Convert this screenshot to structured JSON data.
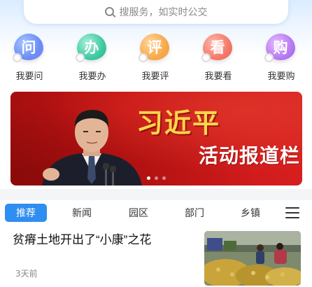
{
  "search": {
    "placeholder": "搜服务，如实时公交"
  },
  "actions": [
    {
      "glyph": "问",
      "label": "我要问",
      "icon": "ask-icon"
    },
    {
      "glyph": "办",
      "label": "我要办",
      "icon": "handle-icon"
    },
    {
      "glyph": "评",
      "label": "我要评",
      "icon": "review-icon"
    },
    {
      "glyph": "看",
      "label": "我要看",
      "icon": "watch-icon"
    },
    {
      "glyph": "购",
      "label": "我要购",
      "icon": "shop-icon"
    }
  ],
  "banner": {
    "title": "习近平",
    "subtitle": "活动报道栏",
    "pages": 3,
    "active_page": 1
  },
  "tabs": [
    {
      "label": "推荐",
      "active": true
    },
    {
      "label": "新闻",
      "active": false
    },
    {
      "label": "园区",
      "active": false
    },
    {
      "label": "部门",
      "active": false
    },
    {
      "label": "乡镇",
      "active": false
    }
  ],
  "news": [
    {
      "headline": "贫瘠土地开出了“小康”之花",
      "time": "3天前"
    }
  ],
  "colors": {
    "accent": "#2f8ef0",
    "banner_red": "#c81515",
    "banner_gold": "#ffd54a"
  }
}
